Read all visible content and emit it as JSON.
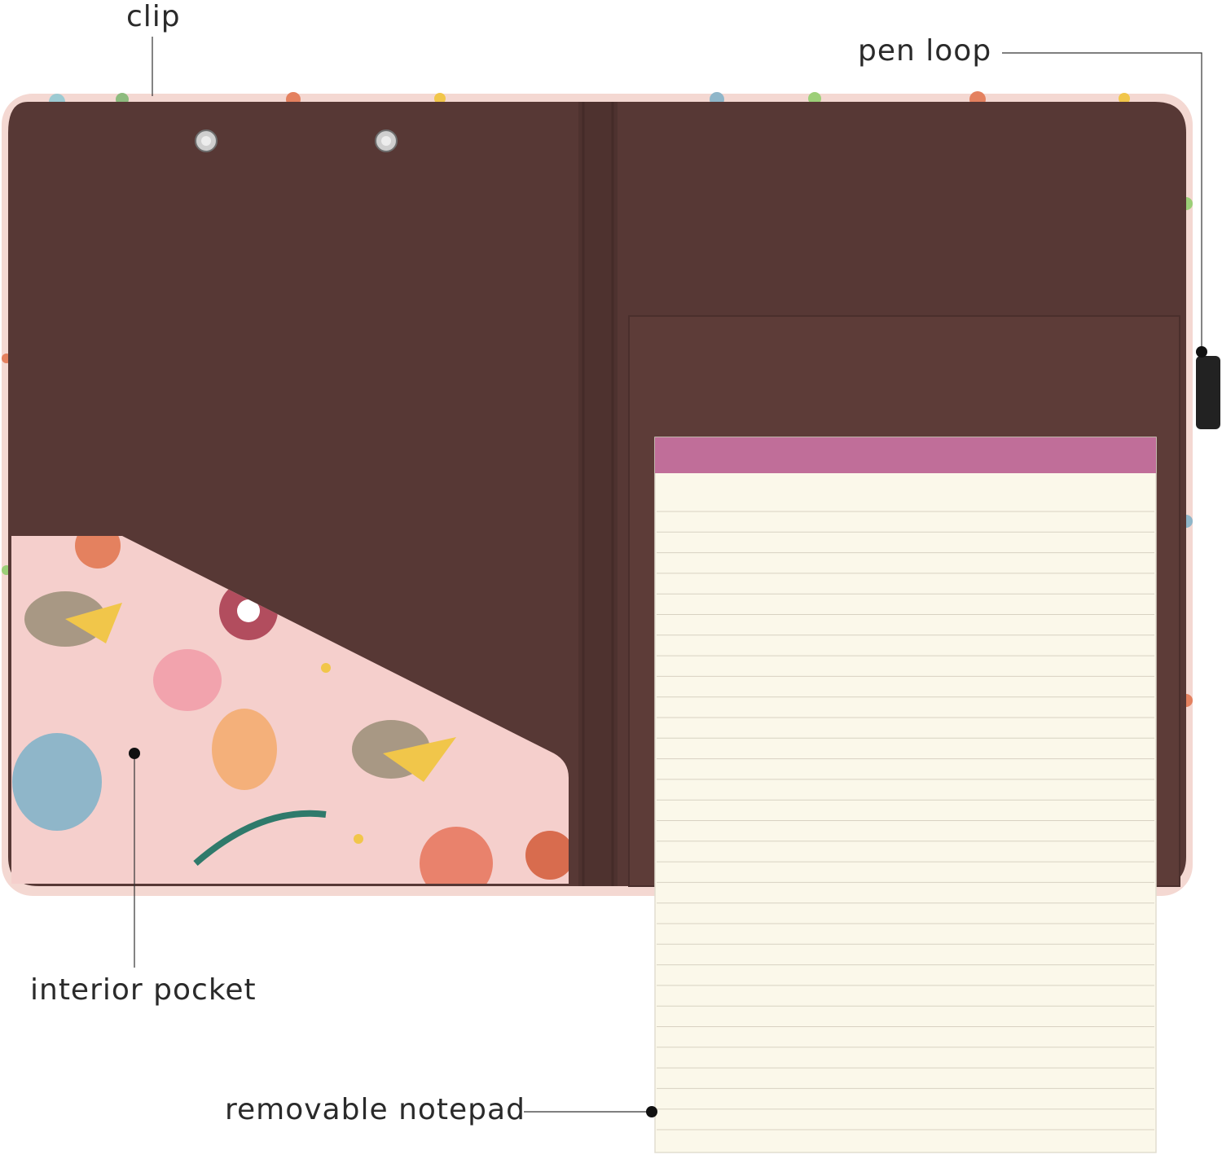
{
  "labels": {
    "clip": "clip",
    "pen_loop": "pen loop",
    "interior_pocket": "interior pocket",
    "removable_notepad": "removable notepad"
  },
  "colors": {
    "cover_brown": "#573835",
    "pad_header": "#c06e99",
    "paper": "#fbf8ea",
    "pocket_pink": "#f5cfcc",
    "line_color": "#d8d2c2",
    "leader": "#333333"
  }
}
